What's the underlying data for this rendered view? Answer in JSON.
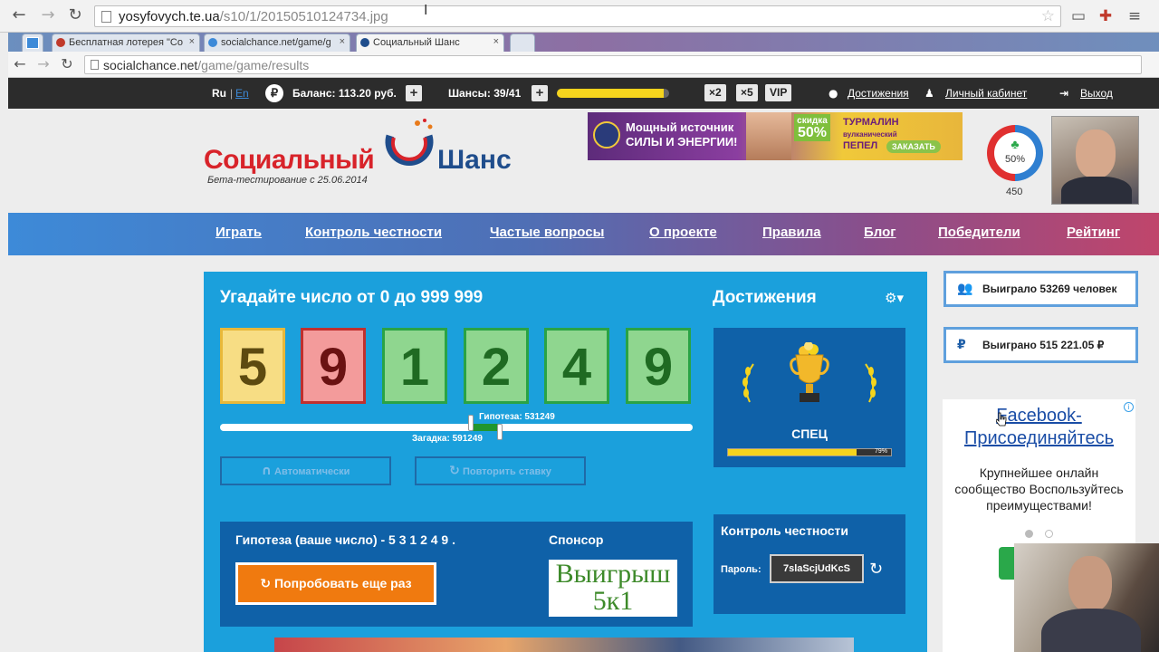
{
  "outer_browser": {
    "url_host": "yosyfovych.te.ua",
    "url_path": "/s10/1/20150510124734.jpg"
  },
  "inner_browser": {
    "tabs": [
      {
        "title": "Бесплатная лотерея \"Со"
      },
      {
        "title": "socialchance.net/game/g"
      },
      {
        "title": "Социальный Шанс"
      }
    ],
    "url_host": "socialchance.net",
    "url_path": "/game/game/results"
  },
  "topbar": {
    "lang_ru": "Ru",
    "lang_sep": "|",
    "lang_en": "En",
    "balance_label": "Баланс:",
    "balance_value": "113.20 руб.",
    "chances_label": "Шансы:",
    "chances_value": "39/41",
    "chances_progress": 0.95,
    "mult_2": "×2",
    "mult_5": "×5",
    "vip": "VIP",
    "achievements": "Достижения",
    "cabinet": "Личный кабинет",
    "logout": "Выход"
  },
  "header": {
    "logo_word1": "Социальный",
    "logo_word2": "Шанс",
    "logo_sub": "Бета-тестирование с 25.06.2014",
    "banner_line1": "Мощный источник",
    "banner_line2": "СИЛЫ И ЭНЕРГИИ!",
    "banner_discount_label": "скидка",
    "banner_discount": "50%",
    "banner_product1": "ТУРМАЛИН",
    "banner_product2": "вулканический",
    "banner_product3": "ПЕПЕЛ",
    "banner_order": "ЗАКАЗАТЬ",
    "luck_percent": "50%",
    "luck_count": "450"
  },
  "nav": {
    "items": [
      "Играть",
      "Контроль честности",
      "Частые вопросы",
      "О проекте",
      "Правила",
      "Блог",
      "Победители",
      "Рейтинг"
    ]
  },
  "game": {
    "title": "Угадайте число от 0 до 999 999",
    "digits": [
      "5",
      "9",
      "1",
      "2",
      "4",
      "9"
    ],
    "hypothesis_marker": "Гипотеза: 531249",
    "target_marker": "Загадка: 591249",
    "hypothesis_value": 531249,
    "target_value": 591249,
    "auto_button": "Автоматически",
    "repeat_button": "Повторить ставку",
    "hypothesis_text": "Гипотеза (ваше число) - 5 3 1 2 4 9 .",
    "retry_button": "Попробовать еще раз",
    "sponsor_label": "Спонсор",
    "sponsor_line1": "Выигрыш",
    "sponsor_line2": "5к1",
    "achievements_title": "Достижения",
    "achievement_name": "СПЕЦ",
    "achievement_progress": 0.79,
    "achievement_pct": "79%",
    "honesty_title": "Контроль честности",
    "password_label": "Пароль:",
    "password_value": "7slaScjUdKcS"
  },
  "sidebar": {
    "winners": "Выиграло 53269 человек",
    "won": "Выиграно 515 221.05 ₽",
    "ad_title": "Facebook-Присоединяйтесь",
    "ad_body": "Крупнейшее онлайн сообщество Воспользуйтесь преимуществами!"
  },
  "colors": {
    "game_bg": "#1ba0dc",
    "panel_dark": "#0f61a8",
    "digit_yellow": "#f7dd84",
    "digit_red": "#f39b9b",
    "digit_green": "#8fd68f",
    "retry_orange": "#f07a0f"
  }
}
